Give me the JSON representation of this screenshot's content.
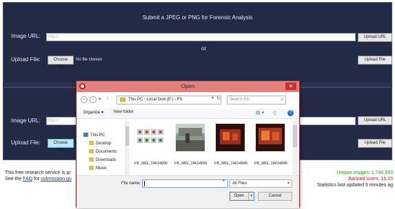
{
  "page": {
    "banner": "Submit a JPEG or PNG for Forensic Analysis",
    "or_text": "or",
    "top": {
      "image_url_label": "Image URL:",
      "image_url_placeholder": "http://",
      "upload_url_button": "Upload URL",
      "upload_file_label": "Upload File:",
      "choose_file_button": "Choose File",
      "file_status": "No file chosen",
      "upload_file_button": "Upload File"
    },
    "bottom": {
      "image_url_label": "Image URL:",
      "image_url_placeholder": "http://",
      "upload_url_button": "Upload URL",
      "upload_file_label": "Upload File:",
      "choose_file_button": "Choose File",
      "upload_file_button": "Upload File"
    },
    "footer": {
      "line1": "This free research service is pr",
      "line2_prefix": "See the ",
      "faq_link": "FAQ",
      "line2_middle": " for ",
      "guidelines_link": "submission gu",
      "unique_images": "Unique images: 1,740,993",
      "banned_users": "Banned users: 16,15",
      "stats_updated": "Statistics last updated 3 minutes ag"
    }
  },
  "dialog": {
    "title": "Open",
    "close_glyph": "✕",
    "breadcrumb": "This PC  ›  Local Disk (E:)  ›  Fb",
    "search_placeholder": "Search Fb",
    "organize_label": "Organize ▾",
    "new_folder_label": "New folder",
    "nav_items": [
      {
        "label": "This PC",
        "icon": "pc-icon"
      },
      {
        "label": "Desktop",
        "icon": "folder-icon"
      },
      {
        "label": "Documents",
        "icon": "folder-icon"
      },
      {
        "label": "Downloads",
        "icon": "folder-icon"
      },
      {
        "label": "Music",
        "icon": "music-folder-icon"
      }
    ],
    "files": [
      {
        "name": "FB_IMG_14614890"
      },
      {
        "name": "FB_IMG_14614891"
      },
      {
        "name": "FB_IMG_14614895"
      },
      {
        "name": "FB_IMG_14614895"
      }
    ],
    "file_name_label": "File name:",
    "file_name_value": "",
    "file_type_filter": "All Files",
    "open_button": "Open",
    "cancel_button": "Cancel"
  }
}
